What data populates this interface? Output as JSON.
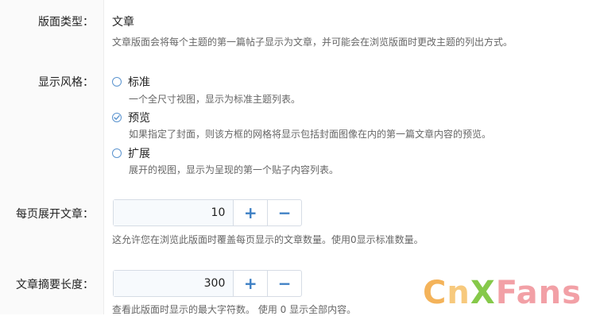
{
  "layout_type": {
    "label": "版面类型：",
    "value": "文章",
    "help": "文章版面会将每个主题的第一篇帖子显示为文章，并可能会在浏览版面时更改主题的列出方式。"
  },
  "display_style": {
    "label": "显示风格：",
    "options": [
      {
        "label": "标准",
        "help": "一个全尺寸视图，显示为标准主题列表。",
        "selected": false
      },
      {
        "label": "预览",
        "help": "如果指定了封面，则该方框的网格将显示包括封面图像在内的第一篇文章内容的预览。",
        "selected": true
      },
      {
        "label": "扩展",
        "help": "展开的视图，显示为呈现的第一个贴子内容列表。",
        "selected": false
      }
    ]
  },
  "articles_per_page": {
    "label": "每页展开文章：",
    "value": "10",
    "plus": "+",
    "minus": "−",
    "help": "这允许您在浏览此版面时覆盖每页显示的文章数量。使用0显示标准数量。"
  },
  "excerpt_length": {
    "label": "文章摘要长度：",
    "value": "300",
    "plus": "+",
    "minus": "−",
    "help": "查看此版面时显示的最大字符数。 使用 0 显示全部内容。"
  },
  "watermark": {
    "c": "C",
    "n": "n",
    "x": "X",
    "fans": "Fans"
  },
  "colors": {
    "accent": "#3d7fc4",
    "radio": "#5b94cf"
  }
}
